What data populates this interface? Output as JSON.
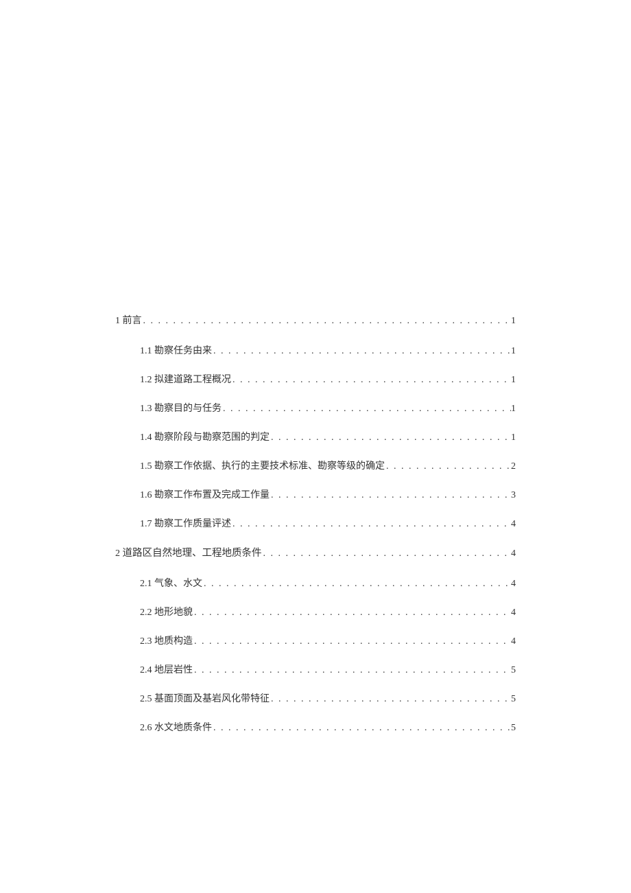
{
  "toc": [
    {
      "level": 1,
      "num": "1",
      "title": "前言",
      "page": "1",
      "style": "plain"
    },
    {
      "level": 2,
      "num": "1.1",
      "title": "勘察任务由来",
      "page": "1",
      "style": "plain"
    },
    {
      "level": 2,
      "num": "1.2",
      "title": "拟建道路工程概况",
      "page": "1",
      "style": "plain"
    },
    {
      "level": 2,
      "num": "1.3",
      "title": "勘察目的与任务",
      "page": "1",
      "style": "plain"
    },
    {
      "level": 2,
      "num": "1.4",
      "title": "勘察阶段与勘察范围的判定",
      "page": "1",
      "style": "plain"
    },
    {
      "level": 2,
      "num": "1.5",
      "title": "勘察工作依据、执行的主要技术标准、勘察等级的确定",
      "page": "2",
      "style": "plain"
    },
    {
      "level": 2,
      "num": "1.6",
      "title": "勘察工作布置及完成工作量",
      "page": "3",
      "style": "plain"
    },
    {
      "level": 2,
      "num": "1.7",
      "title": "勘察工作质量评述",
      "page": "4",
      "style": "plain"
    },
    {
      "level": 1,
      "num": "2",
      "title": "道路区自然地理、工程地质条件",
      "page": "4",
      "style": "bold"
    },
    {
      "level": 2,
      "num": "2.1",
      "title": "气象、水文",
      "page": "4",
      "style": "plain"
    },
    {
      "level": 2,
      "num": "2.2",
      "title": "地形地貌",
      "page": "4",
      "style": "plain"
    },
    {
      "level": 2,
      "num": "2.3",
      "title": "地质构造",
      "page": "4",
      "style": "plain"
    },
    {
      "level": 2,
      "num": "2.4",
      "title": "地层岩性",
      "page": "5",
      "style": "plain"
    },
    {
      "level": 2,
      "num": "2.5",
      "title": "基面顶面及基岩风化带特征",
      "page": "5",
      "style": "plain"
    },
    {
      "level": 2,
      "num": "2.6",
      "title": "水文地质条件",
      "page": "5",
      "style": "plain"
    }
  ],
  "dots": ". . . . . . . . . . . . . . . . . . . . . . . . . . . . . . . . . . . . . . . . . . . . . . . . . . . . . . . . . . . . . . . . . . . . . . . . . . . . . . . . . . . . . . . . . . . . . . . . . . . . . . . . . . . . . . . . . . . . . . . . . . . . ."
}
